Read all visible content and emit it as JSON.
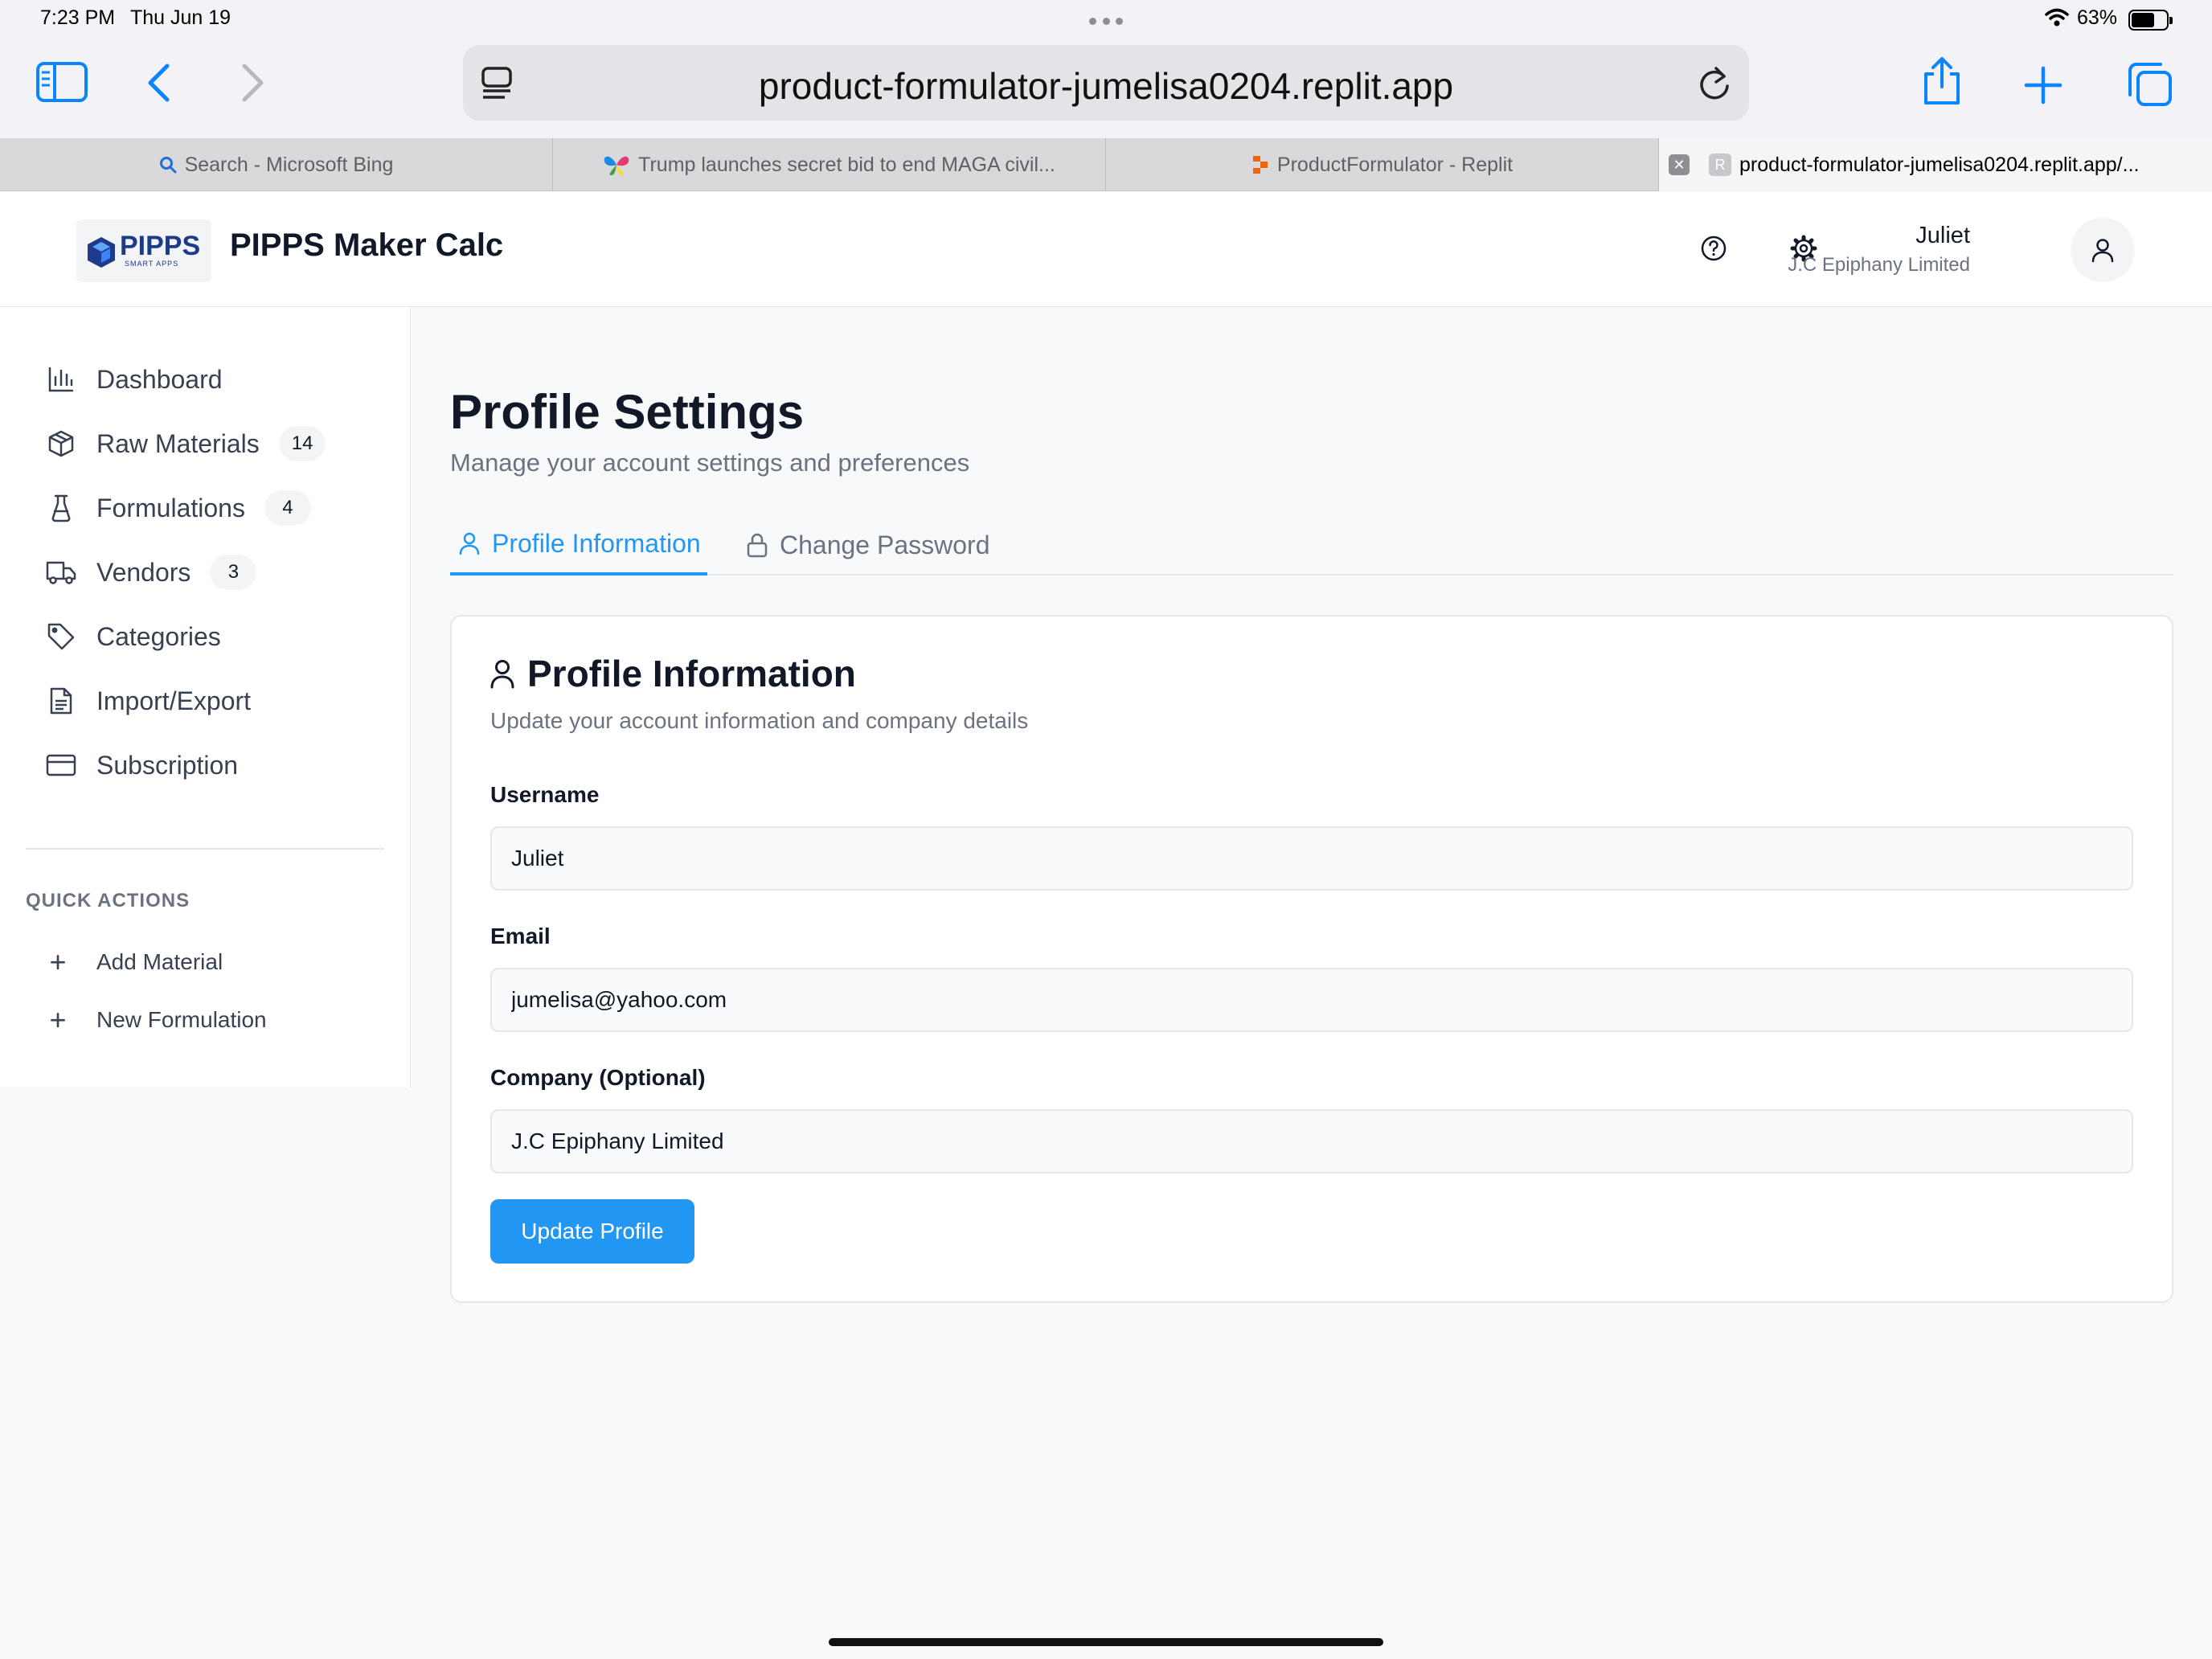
{
  "status_bar": {
    "time": "7:23 PM",
    "date": "Thu Jun 19",
    "battery": "63%",
    "battery_level": 0.63
  },
  "browser": {
    "url": "product-formulator-jumelisa0204.replit.app",
    "tabs": [
      {
        "label": "Search - Microsoft Bing",
        "icon": "search-icon"
      },
      {
        "label": "Trump launches secret bid to end MAGA civil...",
        "icon": "butterfly-favicon"
      },
      {
        "label": "ProductFormulator - Replit",
        "icon": "replit-favicon"
      },
      {
        "label": "product-formulator-jumelisa0204.replit.app/...",
        "icon": "r-favicon",
        "favicon_letter": "R",
        "active": true
      }
    ],
    "accent": "#0a84ff"
  },
  "header": {
    "logo_text": "PIPPS",
    "logo_sub": "SMART APPS",
    "app_title": "PIPPS Maker Calc",
    "user_name": "Juliet",
    "user_company": "J.C Epiphany Limited"
  },
  "sidebar": {
    "items": [
      {
        "label": "Dashboard",
        "icon": "bar-chart-icon"
      },
      {
        "label": "Raw Materials",
        "icon": "package-icon",
        "badge": "14"
      },
      {
        "label": "Formulations",
        "icon": "flask-icon",
        "badge": "4"
      },
      {
        "label": "Vendors",
        "icon": "truck-icon",
        "badge": "3"
      },
      {
        "label": "Categories",
        "icon": "tag-icon"
      },
      {
        "label": "Import/Export",
        "icon": "file-icon"
      },
      {
        "label": "Subscription",
        "icon": "credit-card-icon"
      }
    ],
    "quick_actions_heading": "QUICK ACTIONS",
    "quick_actions": [
      {
        "label": "Add Material",
        "icon": "plus-icon"
      },
      {
        "label": "New Formulation",
        "icon": "plus-icon"
      }
    ]
  },
  "main": {
    "title": "Profile Settings",
    "subtitle": "Manage your account settings and preferences",
    "tabs": [
      {
        "label": "Profile Information",
        "icon": "user-icon",
        "active": true
      },
      {
        "label": "Change Password",
        "icon": "lock-icon",
        "active": false
      }
    ],
    "card": {
      "title": "Profile Information",
      "subtitle": "Update your account information and company details",
      "fields": [
        {
          "label": "Username",
          "value": "Juliet"
        },
        {
          "label": "Email",
          "value": "jumelisa@yahoo.com"
        },
        {
          "label": "Company (Optional)",
          "value": "J.C Epiphany Limited"
        }
      ],
      "submit_label": "Update Profile"
    },
    "accent": "#2196f3"
  }
}
